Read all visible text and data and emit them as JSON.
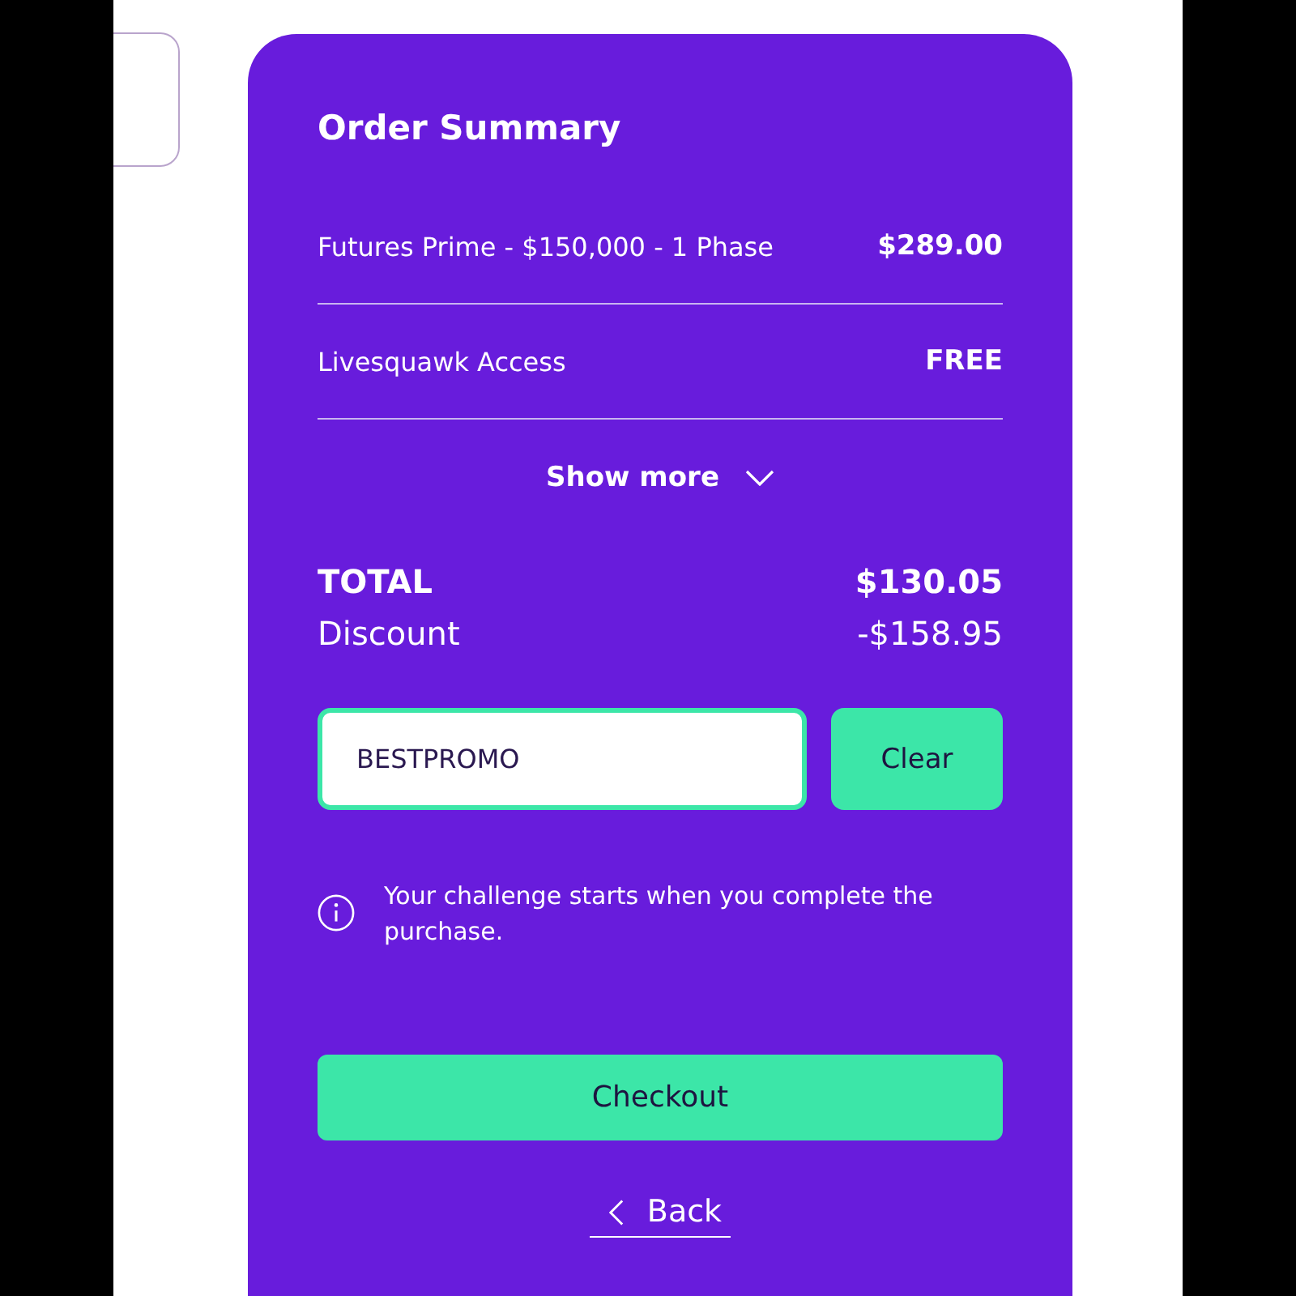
{
  "order_summary": {
    "title": "Order Summary",
    "items": [
      {
        "name": "Futures Prime - $150,000 - 1 Phase",
        "price": "$289.00"
      },
      {
        "name": "Livesquawk Access",
        "price": "FREE"
      }
    ],
    "show_more": {
      "label": "Show more",
      "expanded": false
    },
    "totals": [
      {
        "kind": "total",
        "label": "TOTAL",
        "amount": "$130.05"
      },
      {
        "kind": "discount",
        "label": "Discount",
        "amount": "-$158.95"
      }
    ],
    "promo": {
      "value": "BESTPROMO",
      "button": "Clear"
    },
    "notice": "Your challenge starts when you complete the purchase.",
    "checkout": "Checkout",
    "back": "Back"
  }
}
